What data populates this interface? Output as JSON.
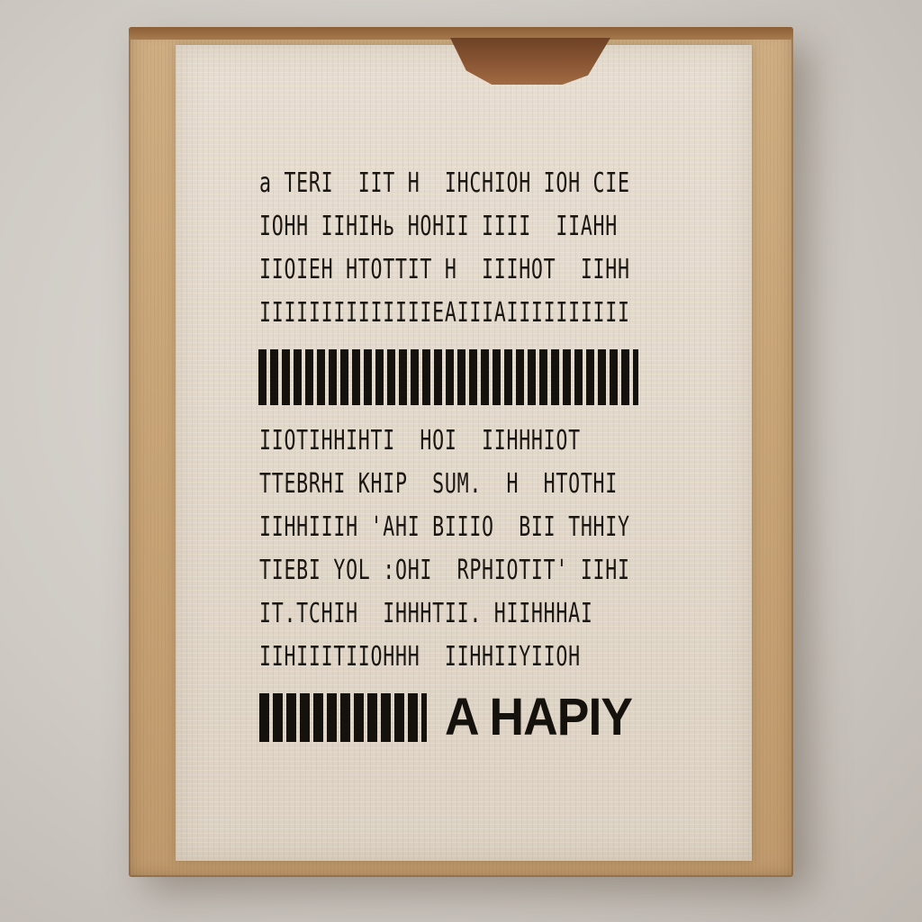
{
  "sign": {
    "lines_top": [
      "а TERI  IIT H  IHCHIOH IOH CIE",
      "IOHH IIHIHь HOHII IIII  IIAHH",
      "IIOIEH HTOTTIT H  IIIHOT  IIHH",
      "IIIIIIIIIIIIIIEAIIIAIIIIIIIIII"
    ],
    "lines_bottom": [
      "IIOTIHHIHTI  HOI  IIHHHIOT",
      "TTEBRHI KHIP  SUM.  H  HTOTHI",
      "IIHHIIIH 'AHI BIIIO  BII THHIY",
      "TIEBI YOL :OHI  RPHIOTIT' IIHI",
      "IT.TCHIH  IHHHTII. HIIHHHAI",
      "IIHIIITIIOHHH  IIHHIIYIIOH"
    ],
    "closing_text": "A HAPIY",
    "colors": {
      "ink": "#15110d",
      "paper": "#e2d8ca",
      "board": "#c9a679",
      "wall": "#d4cfc9"
    }
  }
}
